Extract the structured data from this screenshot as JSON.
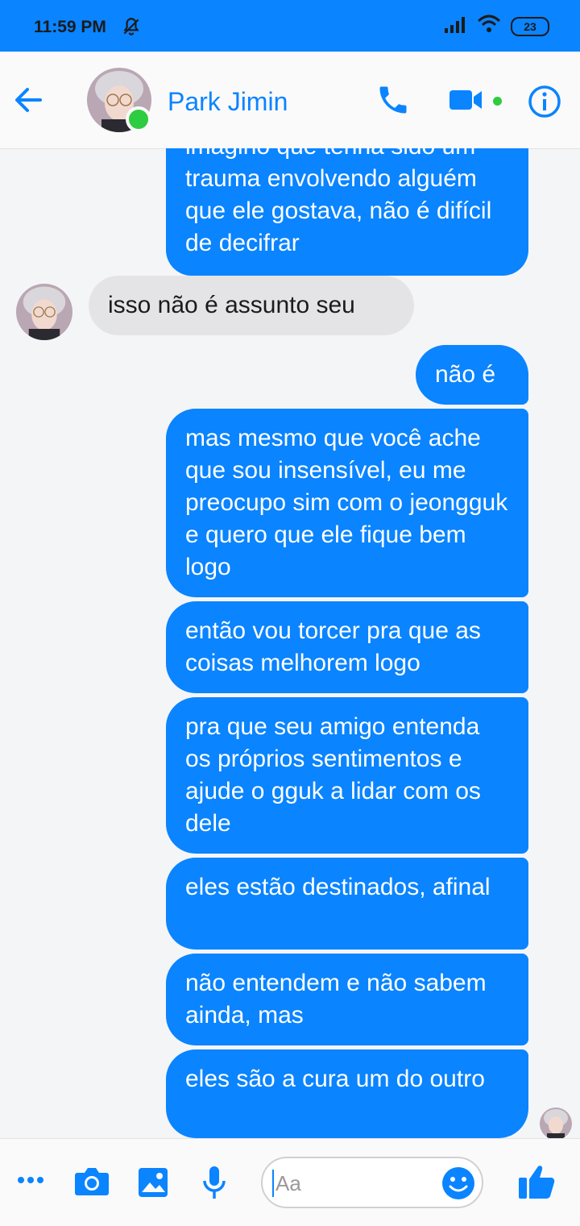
{
  "status_bar": {
    "time": "11:59 PM",
    "battery": "23"
  },
  "header": {
    "contact_name": "Park Jimin"
  },
  "messages": [
    {
      "side": "out",
      "text": "imagino que tenha sido um trauma envolvendo alguém que ele gostava, não é difícil de decifrar"
    },
    {
      "side": "in",
      "text": "isso não é assunto seu"
    },
    {
      "side": "out",
      "text": "não é"
    },
    {
      "side": "out",
      "text": "mas mesmo que você ache que sou insensível, eu me preocupo sim com o jeongguk e quero que ele fique bem logo"
    },
    {
      "side": "out",
      "text": "então vou torcer pra que as coisas melhorem logo"
    },
    {
      "side": "out",
      "text": "pra que seu amigo entenda os próprios sentimentos e ajude o gguk a lidar com os dele"
    },
    {
      "side": "out",
      "text": "eles estão destinados, afinal"
    },
    {
      "side": "out",
      "text": "não entendem e não sabem ainda, mas"
    },
    {
      "side": "out",
      "text": "eles são a cura um do outro"
    }
  ],
  "composer": {
    "placeholder": "Aa"
  },
  "colors": {
    "accent": "#0a84ff",
    "incoming_bubble": "#e4e4e6",
    "online": "#2ecc40"
  }
}
